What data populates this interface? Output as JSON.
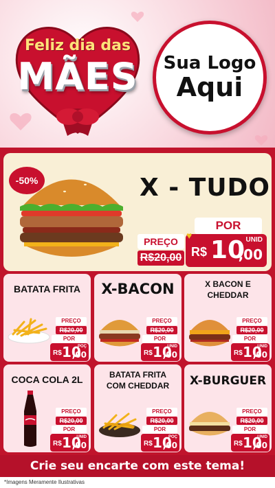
{
  "header": {
    "greeting_line1": "Feliz dia das",
    "greeting_line2": "MÃES",
    "logo_line1": "Sua Logo",
    "logo_line2": "Aqui"
  },
  "featured": {
    "name": "X - TUDO",
    "discount": "-50%",
    "price_label": "PREÇO",
    "old_price": "R$20,00",
    "por_label": "POR",
    "currency": "R$",
    "price_int": "10",
    "price_cents": ",00",
    "unit": "UNID"
  },
  "products": [
    {
      "name": "BATATA FRITA",
      "image": "fries-icon",
      "price_label": "PREÇO",
      "old_price": "R$20,00",
      "por_label": "POR",
      "currency": "R$",
      "price_int": "10",
      "price_cents": ",00",
      "unit": "POÇ"
    },
    {
      "name": "X-BACON",
      "image": "burger-icon",
      "price_label": "PREÇO",
      "old_price": "R$20,00",
      "por_label": "POR",
      "currency": "R$",
      "price_int": "10",
      "price_cents": ",00",
      "unit": "UNID"
    },
    {
      "name": "X BACON E CHEDDAR",
      "image": "burger-cheddar-icon",
      "price_label": "PREÇO",
      "old_price": "R$20,00",
      "por_label": "POR",
      "currency": "R$",
      "price_int": "10",
      "price_cents": ",00",
      "unit": "UNID"
    },
    {
      "name": "COCA COLA 2L",
      "image": "soda-bottle-icon",
      "price_label": "PREÇO",
      "old_price": "R$20,00",
      "por_label": "POR",
      "currency": "R$",
      "price_int": "10",
      "price_cents": ",00",
      "unit": "UNID"
    },
    {
      "name": "BATATA FRITA COM CHEDDAR",
      "image": "fries-cheddar-icon",
      "price_label": "PREÇO",
      "old_price": "R$20,00",
      "por_label": "POR",
      "currency": "R$",
      "price_int": "10",
      "price_cents": ",00",
      "unit": "POÇ"
    },
    {
      "name": "X-BURGUER",
      "image": "burger-icon",
      "price_label": "PREÇO",
      "old_price": "R$20,00",
      "por_label": "POR",
      "currency": "R$",
      "price_int": "10",
      "price_cents": ",00",
      "unit": "UNID"
    }
  ],
  "footer": {
    "cta": "Crie seu encarte com este tema!",
    "disclaimer": "*Imagens Meramente Ilustrativas"
  },
  "colors": {
    "brand_red": "#c8102e",
    "card_pink": "#fde4e9",
    "feature_cream": "#f9efd6",
    "heart_gold": "#f0c020"
  }
}
